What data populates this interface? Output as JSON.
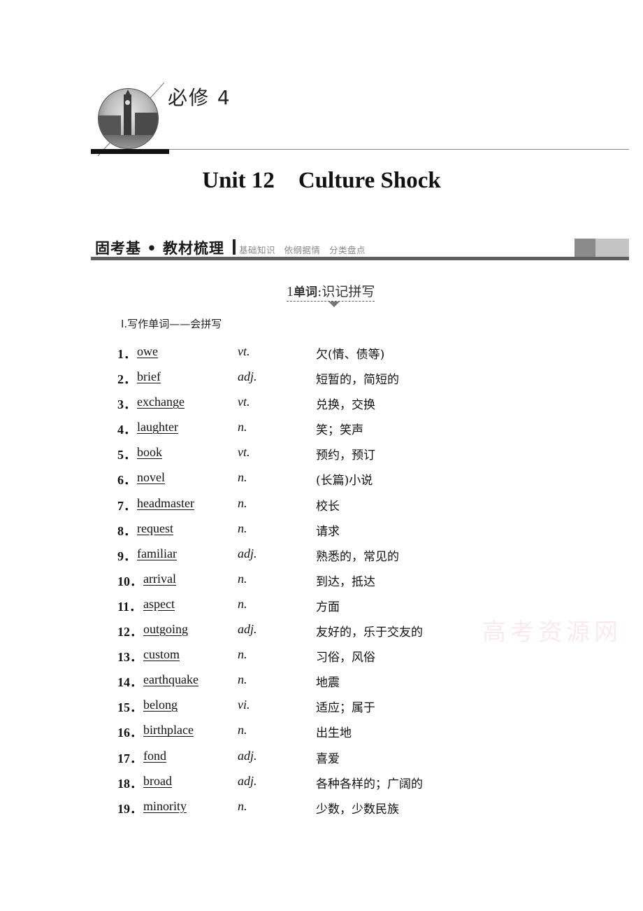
{
  "header": {
    "book_title": "必修 4",
    "image_icon": "big-ben-photo-icon"
  },
  "unit": {
    "number_label": "Unit 12",
    "title": "Culture Shock"
  },
  "section": {
    "main_label": "固考基 • 教材梳理",
    "sub_labels": [
      "基础知识",
      "依纲据情",
      "分类盘点"
    ]
  },
  "subsection": {
    "number": "1",
    "bold_label": "单词",
    "separator": ":",
    "label": "识记拼写"
  },
  "part": {
    "label": "Ⅰ.写作单词——会拼写"
  },
  "words": [
    {
      "idx": "1．",
      "word": "owe",
      "pos": "vt.",
      "meaning": "欠(情、债等)"
    },
    {
      "idx": "2．",
      "word": "brief",
      "pos": "adj.",
      "meaning": "短暂的，简短的"
    },
    {
      "idx": "3．",
      "word": "exchange",
      "pos": "vt.",
      "meaning": "兑换，交换"
    },
    {
      "idx": "4．",
      "word": "laughter",
      "pos": "n.",
      "meaning": "笑；笑声"
    },
    {
      "idx": "5．",
      "word": "book",
      "pos": "vt.",
      "meaning": "预约，预订"
    },
    {
      "idx": "6．",
      "word": "novel",
      "pos": "n.",
      "meaning": "(长篇)小说"
    },
    {
      "idx": "7．",
      "word": "headmaster",
      "pos": "n.",
      "meaning": "校长"
    },
    {
      "idx": "8．",
      "word": "request",
      "pos": "n.",
      "meaning": "请求"
    },
    {
      "idx": "9．",
      "word": "familiar",
      "pos": "adj.",
      "meaning": "熟悉的，常见的"
    },
    {
      "idx": "10．",
      "word": "arrival",
      "pos": "n.",
      "meaning": "到达，抵达"
    },
    {
      "idx": "11．",
      "word": "aspect",
      "pos": "n.",
      "meaning": "方面"
    },
    {
      "idx": "12．",
      "word": "outgoing",
      "pos": "adj.",
      "meaning": "友好的，乐于交友的"
    },
    {
      "idx": "13．",
      "word": "custom",
      "pos": "n.",
      "meaning": "习俗，风俗"
    },
    {
      "idx": "14．",
      "word": "earthquake",
      "pos": "n.",
      "meaning": "地震"
    },
    {
      "idx": "15．",
      "word": "belong",
      "pos": "vi.",
      "meaning": "适应；属于"
    },
    {
      "idx": "16．",
      "word": "birthplace",
      "pos": "n.",
      "meaning": "出生地"
    },
    {
      "idx": "17．",
      "word": "fond",
      "pos": "adj.",
      "meaning": "喜爱"
    },
    {
      "idx": "18．",
      "word": "broad",
      "pos": "adj.",
      "meaning": "各种各样的；广阔的"
    },
    {
      "idx": "19．",
      "word": "minority",
      "pos": "n.",
      "meaning": "少数，少数民族"
    }
  ],
  "watermark": "高考资源网"
}
